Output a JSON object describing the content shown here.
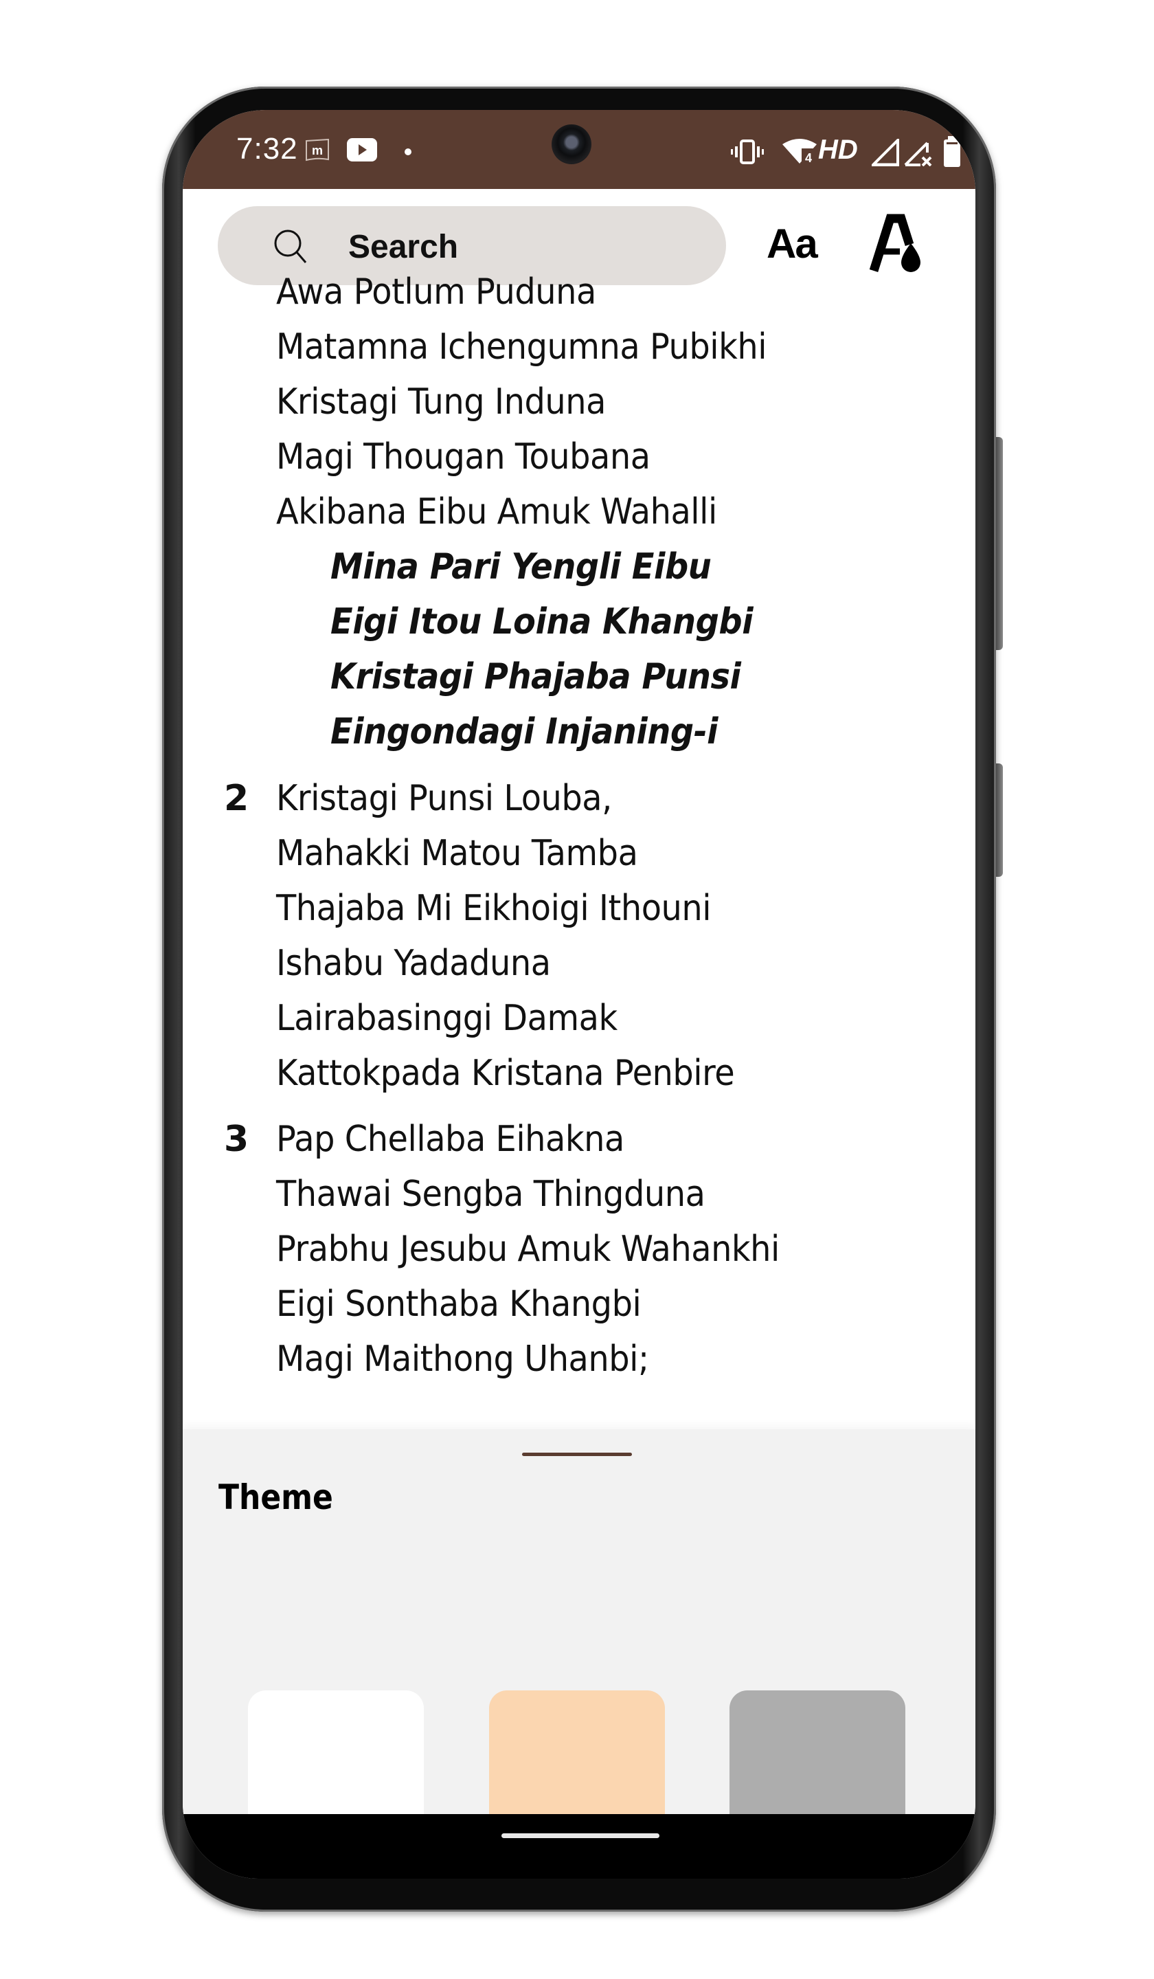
{
  "status_bar": {
    "time": "7:32",
    "left_icons": [
      "m-app-notification-icon",
      "youtube-icon",
      "notification-dot-icon"
    ],
    "right_icons": [
      "vibrate-icon",
      "wifi-4-icon",
      "hd-volte-icon",
      "signal-icon",
      "signal-no-service-icon",
      "battery-icon"
    ],
    "hd_label": "HD",
    "wifi_label": "4"
  },
  "toolbar": {
    "search_placeholder": "Search",
    "font_size_label": "Aa",
    "theme_button": "text-color-theme-icon"
  },
  "hymn": {
    "stanzas": [
      {
        "number": "",
        "lines": [
          "Awa Potlum Puduna",
          "Matamna Ichengumna Pubikhi",
          "Kristagi Tung Induna",
          "Magi Thougan Toubana",
          "Akibana Eibu Amuk Wahalli"
        ]
      },
      {
        "type": "chorus",
        "lines": [
          "Mina Pari Yengli Eibu",
          "Eigi Itou Loina Khangbi",
          "Kristagi Phajaba Punsi",
          "Eingondagi Injaning-i"
        ]
      },
      {
        "number": "2",
        "lines": [
          "Kristagi Punsi Louba,",
          "Mahakki Matou Tamba",
          "Thajaba Mi Eikhoigi Ithouni",
          "Ishabu Yadaduna",
          "Lairabasinggi Damak",
          "Kattokpada Kristana Penbire"
        ]
      },
      {
        "number": "3",
        "lines": [
          "Pap Chellaba Eihakna",
          "Thawai Sengba Thingduna",
          "Prabhu Jesubu Amuk Wahankhi",
          "Eigi Sonthaba Khangbi",
          "Magi Maithong Uhanbi;"
        ]
      }
    ]
  },
  "theme_panel": {
    "title": "Theme",
    "options": [
      {
        "name": "white",
        "color": "#ffffff"
      },
      {
        "name": "sepia",
        "color": "#fbd6b0"
      },
      {
        "name": "gray",
        "color": "#adadad"
      }
    ]
  },
  "colors": {
    "accent": "#5a3c30",
    "search_bg": "#e2dedb",
    "panel_bg": "#f2f2f2"
  }
}
